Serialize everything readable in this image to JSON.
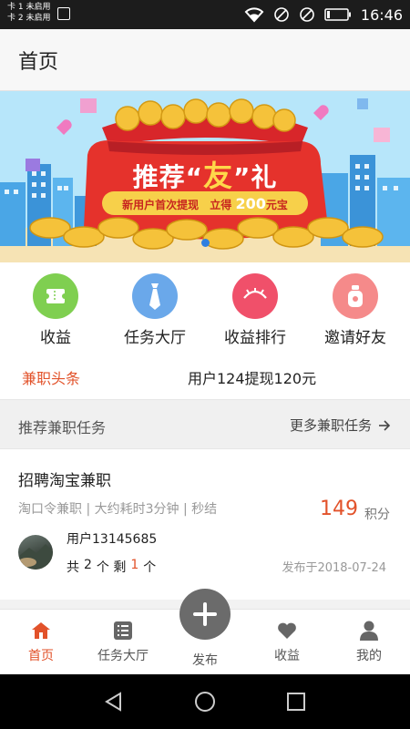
{
  "status_bar": {
    "sim1": "卡 1 未启用",
    "sim2": "卡 2 未启用",
    "time": "16:46"
  },
  "app_bar": {
    "title": "首页"
  },
  "banner": {
    "title_prefix": "推荐“",
    "title_highlight": "友",
    "title_suffix": "”礼",
    "subtitle_left": "新用户首次提现",
    "subtitle_mid": "立得",
    "subtitle_amount": "200",
    "subtitle_unit": "元宝"
  },
  "quick_actions": [
    {
      "label": "收益",
      "icon": "ticket-icon",
      "color": "#7fcf50"
    },
    {
      "label": "任务大厅",
      "icon": "tie-icon",
      "color": "#6aa8ea"
    },
    {
      "label": "收益排行",
      "icon": "eye-icon",
      "color": "#f0506a"
    },
    {
      "label": "邀请好友",
      "icon": "bag-icon",
      "color": "#f58a8a"
    }
  ],
  "headline": {
    "tag": "兼职头条",
    "text": "用户124提现120元"
  },
  "section": {
    "title": "推荐兼职任务",
    "more": "更多兼职任务"
  },
  "task": {
    "title": "招聘淘宝兼职",
    "meta": "淘口令兼职 | 大约耗时3分钟 | 秒结",
    "score": "149",
    "score_unit": "积分",
    "user": "用户13145685",
    "count_prefix": "共",
    "total": "2",
    "count_mid": "个 剩",
    "remaining": "1",
    "count_suffix": "个",
    "date": "发布于2018-07-24"
  },
  "bottom_nav": {
    "home": "首页",
    "tasks": "任务大厅",
    "publish": "发布",
    "income": "收益",
    "mine": "我的"
  },
  "colors": {
    "accent": "#e2522a",
    "publish_button": "#6b6b6b"
  }
}
